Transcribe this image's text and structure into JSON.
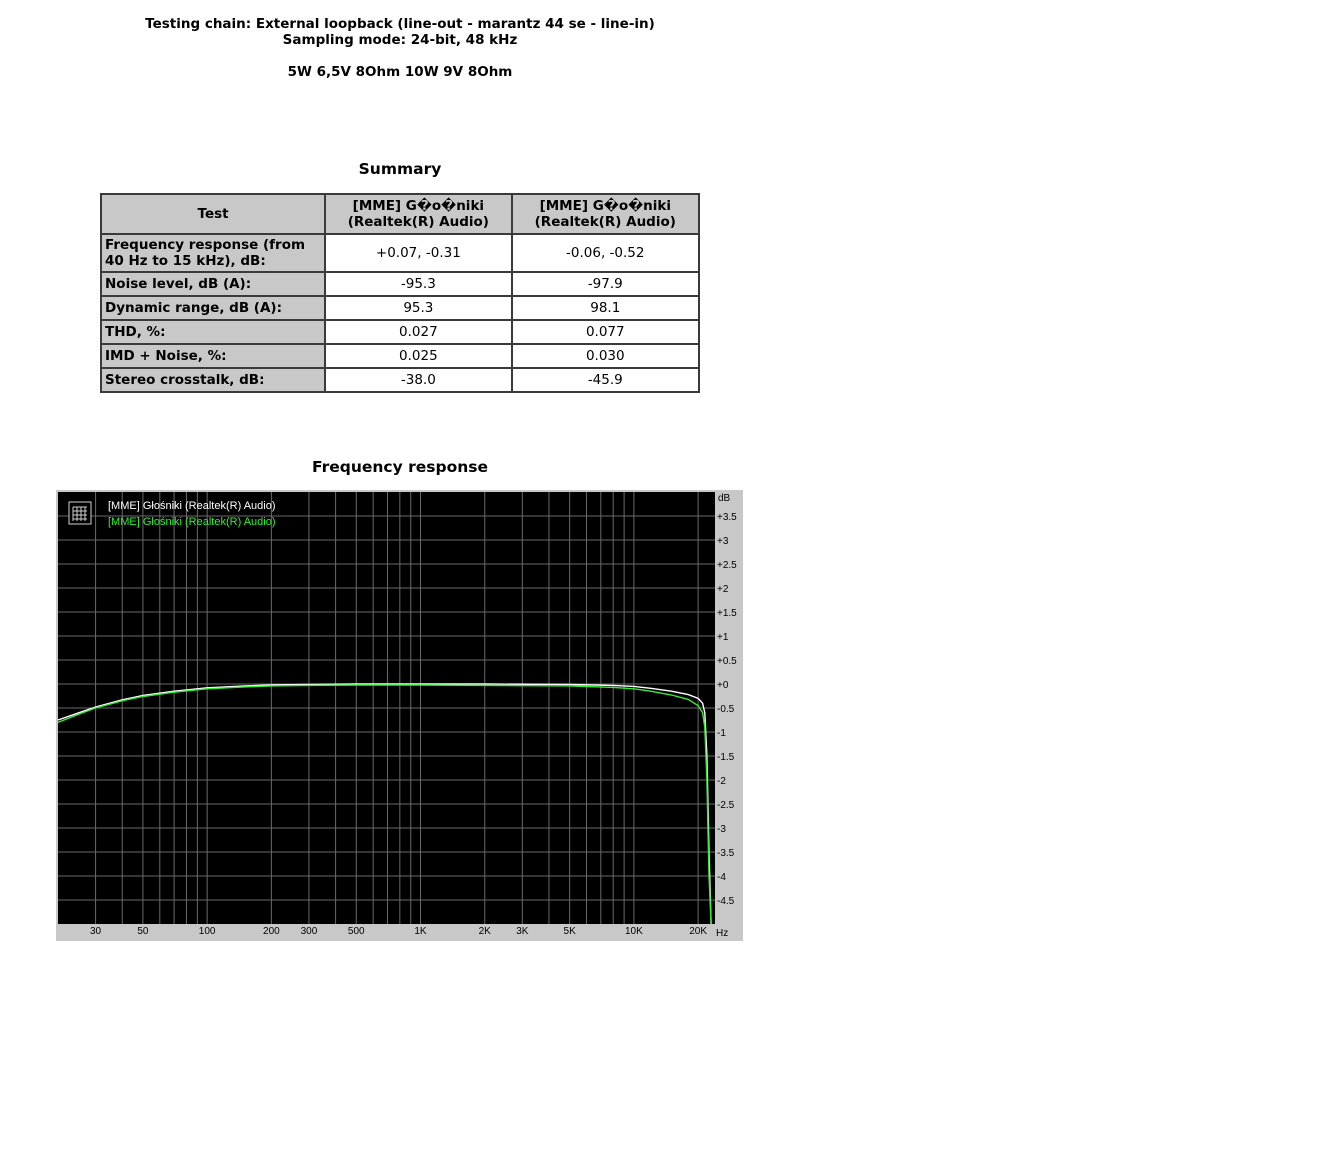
{
  "header": {
    "line1": "Testing chain: External loopback (line-out - marantz 44 se - line-in)",
    "line2": "Sampling mode: 24-bit, 48 kHz",
    "line3": "5W 6,5V 8Ohm 10W 9V 8Ohm"
  },
  "summary": {
    "title": "Summary",
    "columns": [
      "Test",
      "[MME] G�o�niki (Realtek(R) Audio)",
      "[MME] G�o�niki (Realtek(R) Audio)"
    ],
    "rows": [
      {
        "label": "Frequency response (from 40 Hz to 15 kHz), dB:",
        "v1": "+0.07, -0.31",
        "v2": "-0.06, -0.52"
      },
      {
        "label": "Noise level, dB (A):",
        "v1": "-95.3",
        "v2": "-97.9"
      },
      {
        "label": "Dynamic range, dB (A):",
        "v1": "95.3",
        "v2": "98.1"
      },
      {
        "label": "THD, %:",
        "v1": "0.027",
        "v2": "0.077"
      },
      {
        "label": "IMD + Noise, %:",
        "v1": "0.025",
        "v2": "0.030"
      },
      {
        "label": "Stereo crosstalk, dB:",
        "v1": "-38.0",
        "v2": "-45.9"
      }
    ]
  },
  "chart_data": {
    "type": "line",
    "title": "Frequency response",
    "xlabel": "Hz",
    "ylabel": "dB",
    "xscale": "log",
    "xlim": [
      20,
      24000
    ],
    "ylim": [
      -5,
      4
    ],
    "grid": true,
    "legend_position": "top-left",
    "background": "#000000",
    "x_ticks": [
      {
        "v": 30,
        "label": "30"
      },
      {
        "v": 50,
        "label": "50"
      },
      {
        "v": 100,
        "label": "100"
      },
      {
        "v": 200,
        "label": "200"
      },
      {
        "v": 300,
        "label": "300"
      },
      {
        "v": 500,
        "label": "500"
      },
      {
        "v": 1000,
        "label": "1K"
      },
      {
        "v": 2000,
        "label": "2K"
      },
      {
        "v": 3000,
        "label": "3K"
      },
      {
        "v": 5000,
        "label": "5K"
      },
      {
        "v": 10000,
        "label": "10K"
      },
      {
        "v": 20000,
        "label": "20K"
      }
    ],
    "y_ticks": [
      {
        "v": 3.5,
        "label": "+3.5"
      },
      {
        "v": 3,
        "label": "+3"
      },
      {
        "v": 2.5,
        "label": "+2.5"
      },
      {
        "v": 2,
        "label": "+2"
      },
      {
        "v": 1.5,
        "label": "+1.5"
      },
      {
        "v": 1,
        "label": "+1"
      },
      {
        "v": 0.5,
        "label": "+0.5"
      },
      {
        "v": 0,
        "label": "+0"
      },
      {
        "v": -0.5,
        "label": "-0.5"
      },
      {
        "v": -1,
        "label": "-1"
      },
      {
        "v": -1.5,
        "label": "-1.5"
      },
      {
        "v": -2,
        "label": "-2"
      },
      {
        "v": -2.5,
        "label": "-2.5"
      },
      {
        "v": -3,
        "label": "-3"
      },
      {
        "v": -3.5,
        "label": "-3.5"
      },
      {
        "v": -4,
        "label": "-4"
      },
      {
        "v": -4.5,
        "label": "-4.5"
      }
    ],
    "series": [
      {
        "name": "[MME] Głośniki (Realtek(R) Audio)",
        "color": "#ffffff",
        "x": [
          20,
          25,
          30,
          40,
          50,
          70,
          100,
          150,
          200,
          300,
          500,
          1000,
          2000,
          5000,
          8000,
          10000,
          12000,
          15000,
          18000,
          20000,
          21000,
          21500,
          22000,
          22500,
          23000
        ],
        "y": [
          -0.75,
          -0.6,
          -0.48,
          -0.33,
          -0.24,
          -0.15,
          -0.08,
          -0.04,
          -0.02,
          -0.01,
          0,
          0,
          0,
          -0.01,
          -0.03,
          -0.05,
          -0.09,
          -0.15,
          -0.22,
          -0.3,
          -0.4,
          -0.6,
          -1.5,
          -3.5,
          -5
        ]
      },
      {
        "name": "[MME] Głośniki (Realtek(R) Audio)",
        "color": "#33ee33",
        "x": [
          20,
          25,
          30,
          40,
          50,
          70,
          100,
          150,
          200,
          300,
          500,
          1000,
          2000,
          5000,
          8000,
          10000,
          12000,
          15000,
          18000,
          20000,
          21000,
          21500,
          22000,
          22500,
          23000
        ],
        "y": [
          -0.8,
          -0.63,
          -0.5,
          -0.35,
          -0.26,
          -0.17,
          -0.1,
          -0.06,
          -0.04,
          -0.03,
          -0.02,
          -0.02,
          -0.03,
          -0.04,
          -0.07,
          -0.1,
          -0.15,
          -0.23,
          -0.32,
          -0.45,
          -0.6,
          -0.9,
          -2,
          -4,
          -5
        ]
      }
    ]
  }
}
